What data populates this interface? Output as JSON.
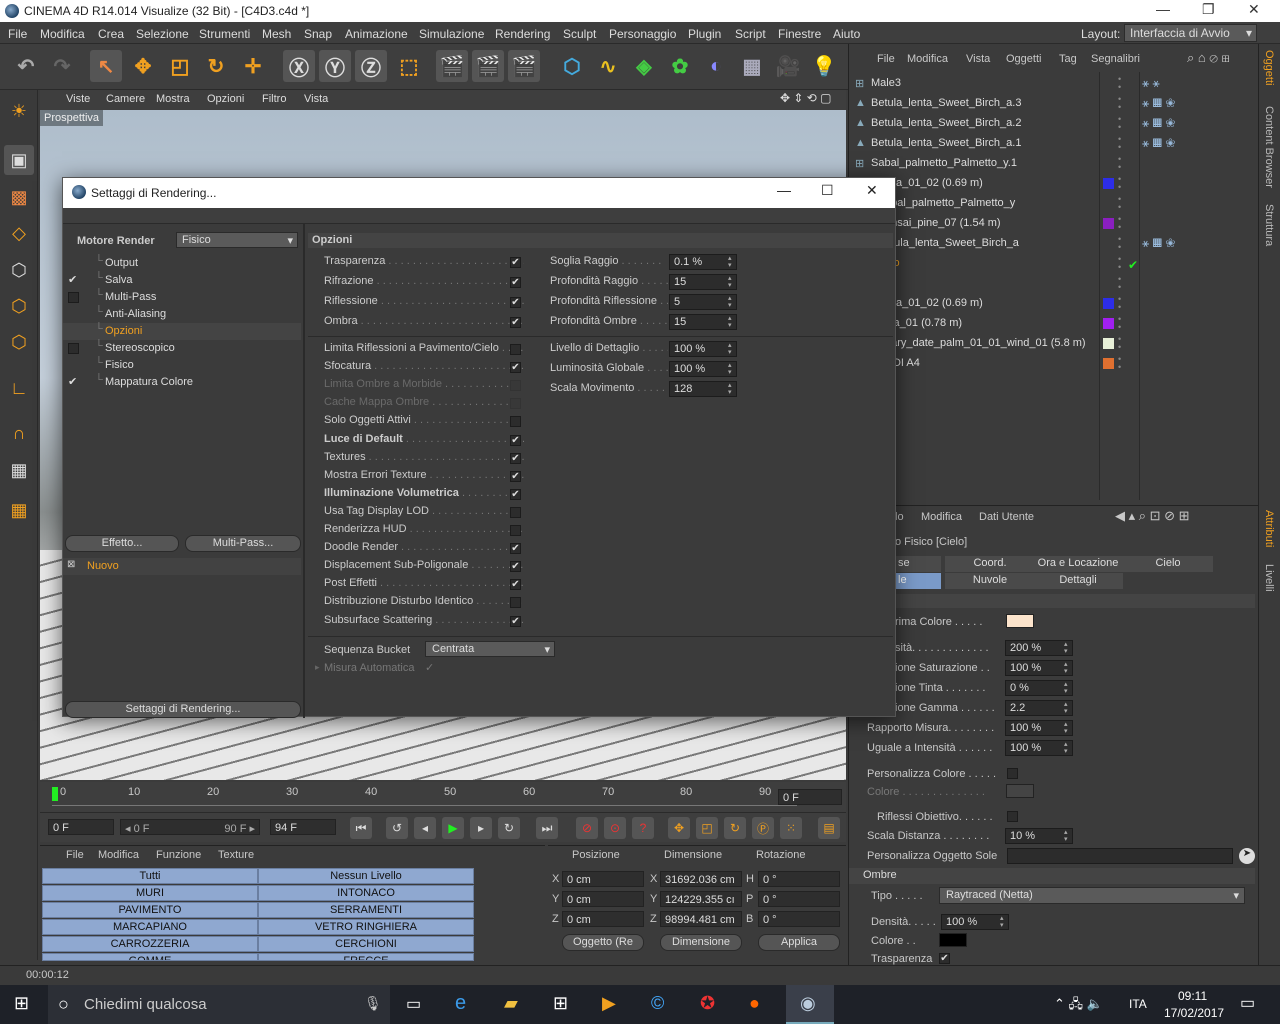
{
  "window": {
    "title": "CINEMA 4D R14.014 Visualize (32 Bit) - [C4D3.c4d *]",
    "min": "—",
    "max": "❐",
    "close": "✕"
  },
  "menu": [
    "File",
    "Modifica",
    "Crea",
    "Selezione",
    "Strumenti",
    "Mesh",
    "Snap",
    "Animazione",
    "Simulazione",
    "Rendering",
    "Sculpt",
    "Personaggio",
    "Plugin",
    "Script",
    "Finestre",
    "Aiuto"
  ],
  "layout": {
    "label": "Layout:",
    "value": "Interfaccia di Avvio"
  },
  "viewport": {
    "menu": [
      "Viste",
      "Camere",
      "Mostra",
      "Opzioni",
      "Filtro",
      "Vista"
    ],
    "label": "Prospettiva"
  },
  "timeline": {
    "ticks": [
      "0",
      "10",
      "20",
      "30",
      "40",
      "50",
      "60",
      "70",
      "80",
      "90"
    ],
    "end_field": "0 F"
  },
  "playback": {
    "f1": "0 F",
    "f2_left": "◂ 0 F",
    "f2_right": "90 F ▸",
    "f3": "94 F"
  },
  "materials": {
    "menu": [
      "File",
      "Modifica",
      "Funzione",
      "Texture"
    ],
    "col1": [
      "Tutti",
      "MURI",
      "PAVIMENTO",
      "MARCAPIANO",
      "CARROZZERIA",
      "GOMME"
    ],
    "col2": [
      "Nessun Livello",
      "INTONACO",
      "SERRAMENTI",
      "VETRO RINGHIERA",
      "CERCHIONI",
      "FRECCE"
    ]
  },
  "coords": {
    "headers": [
      "Posizione",
      "Dimensione",
      "Rotazione"
    ],
    "rows": [
      [
        "X",
        "0 cm",
        "X",
        "31692.036 cm",
        "H",
        "0 °"
      ],
      [
        "Y",
        "0 cm",
        "Y",
        "124229.355 cı",
        "P",
        "0 °"
      ],
      [
        "Z",
        "0 cm",
        "Z",
        "98994.481 cm",
        "B",
        "0 °"
      ]
    ],
    "btn1": "Oggetto (Re",
    "btn2": "Dimensione",
    "apply": "Applica"
  },
  "status": "00:00:12",
  "objects": {
    "menu": [
      "File",
      "Modifica",
      "Vista",
      "Oggetti",
      "Tag",
      "Segnalibri"
    ],
    "items": [
      "Male3",
      "Betula_lenta_Sweet_Birch_a.3",
      "Betula_lenta_Sweet_Birch_a.2",
      "Betula_lenta_Sweet_Birch_a.1",
      "Sabal_palmetto_Palmetto_y.1",
      "cca_01_02 (0.69 m)",
      "abal_palmetto_Palmetto_y",
      "onsai_pine_07 (1.54 m)",
      "etula_lenta_Sweet_Birch_a",
      "elo",
      "",
      "cca_01_02 (0.69 m)",
      "uja_01 (0.78 m)",
      "nary_date_palm_01_01_wind_01 (5.8 m)",
      "UDI A4"
    ],
    "colors": [
      "",
      "",
      "",
      "",
      "",
      "#2d2de8",
      "",
      "#8a1fc0",
      "",
      "",
      "",
      "#2d2de8",
      "#a020f0",
      "#e8f0d8",
      "#e07030"
    ]
  },
  "attributes": {
    "menu": [
      "lo",
      "Modifica",
      "Dati Utente"
    ],
    "title": "o Fisico [Cielo]",
    "tabs1": [
      "se",
      "Coord.",
      "Ora e Locazione",
      "Cielo"
    ],
    "tabs2": [
      "le",
      "Nuvole",
      "Dettagli"
    ],
    "rows": [
      [
        "rima Colore . . . . .",
        ""
      ],
      [
        "sità. . . . . . . . . . . . .",
        "200 %"
      ],
      [
        "ione Saturazione . .",
        "100 %"
      ],
      [
        "ione Tinta . . . . . . .",
        "0 %"
      ],
      [
        "ione Gamma . . . . . .",
        "2.2"
      ],
      [
        "Rapporto Misura. . . . . . . .",
        "100 %"
      ],
      [
        "Uguale a Intensità . . . . . .",
        "100 %"
      ]
    ],
    "pers_color": "Personalizza Colore . . . . .",
    "color": "Colore . . . . . . . . . . . . . .",
    "riflessi": "Riflessi Obiettivo. . . . . .",
    "scala": "Scala Distanza . . . . . . . .",
    "scala_val": "10 %",
    "pers_sun": "Personalizza Oggetto Sole",
    "ombre": "Ombre",
    "tipo": "Tipo . . . . .",
    "tipo_val": "Raytraced (Netta)",
    "densita": "Densità. . . . .",
    "densita_val": "100 %",
    "colore": "Colore . .",
    "trasp": "Trasparenza"
  },
  "right_tabs": [
    "Oggetti",
    "Content Browser",
    "Struttura",
    "Attributi",
    "Livelli"
  ],
  "taskbar": {
    "search": "Chiedimi qualcosa",
    "lang": "ITA",
    "time": "09:11",
    "date": "17/02/2017"
  },
  "dialog": {
    "title": "Settaggi di Rendering...",
    "engine_label": "Motore Render",
    "engine_value": "Fisico",
    "tree": [
      {
        "label": "Output",
        "check": ""
      },
      {
        "label": "Salva",
        "check": "✔"
      },
      {
        "label": "Multi-Pass",
        "check": "box"
      },
      {
        "label": "Anti-Aliasing",
        "check": ""
      },
      {
        "label": "Opzioni",
        "check": "",
        "active": true
      },
      {
        "label": "Stereoscopico",
        "check": "box"
      },
      {
        "label": "Fisico",
        "check": ""
      },
      {
        "label": "Mappatura Colore",
        "check": "✔"
      }
    ],
    "effetto": "Effetto...",
    "multipass": "Multi-Pass...",
    "nuovo": "Nuovo",
    "settaggi_btn": "Settaggi di Rendering...",
    "section": "Opzioni",
    "opts1": [
      [
        "Trasparenza",
        true
      ],
      [
        "Rifrazione",
        true
      ],
      [
        "Riflessione",
        true
      ],
      [
        "Ombra",
        true
      ]
    ],
    "right1": [
      [
        "Soglia Raggio",
        "0.1 %"
      ],
      [
        "Profondità Raggio",
        "15"
      ],
      [
        "Profondità Riflessione",
        "5"
      ],
      [
        "Profondità Ombre",
        "15"
      ]
    ],
    "opts2": [
      [
        "Limita Riflessioni a Pavimento/Cielo",
        false,
        false,
        false
      ],
      [
        "Sfocatura",
        true,
        false,
        false
      ],
      [
        "Limita Ombre a Morbide",
        false,
        true,
        false
      ],
      [
        "Cache Mappa Ombre",
        false,
        true,
        false
      ],
      [
        "Solo Oggetti Attivi",
        false,
        false,
        false
      ],
      [
        "Luce di Default",
        true,
        false,
        true
      ],
      [
        "Textures",
        true,
        false,
        false
      ],
      [
        "Mostra Errori Texture",
        true,
        false,
        false
      ],
      [
        "Illuminazione Volumetrica",
        true,
        false,
        true
      ],
      [
        "Usa Tag Display LOD",
        false,
        false,
        false
      ],
      [
        "Renderizza HUD",
        false,
        false,
        false
      ],
      [
        "Doodle Render",
        true,
        false,
        false
      ],
      [
        "Displacement Sub-Poligonale",
        true,
        false,
        false
      ],
      [
        "Post Effetti",
        true,
        false,
        false
      ],
      [
        "Distribuzione Disturbo Identico",
        false,
        false,
        false
      ],
      [
        "Subsurface Scattering",
        true,
        false,
        false
      ]
    ],
    "right2": [
      [
        "Livello di Dettaglio",
        "100 %"
      ],
      [
        "Luminosità Globale",
        "100 %"
      ],
      [
        "Scala Movimento",
        "128"
      ]
    ],
    "bucket_label": "Sequenza Bucket",
    "bucket_value": "Centrata",
    "misura": "Misura Automatica"
  }
}
